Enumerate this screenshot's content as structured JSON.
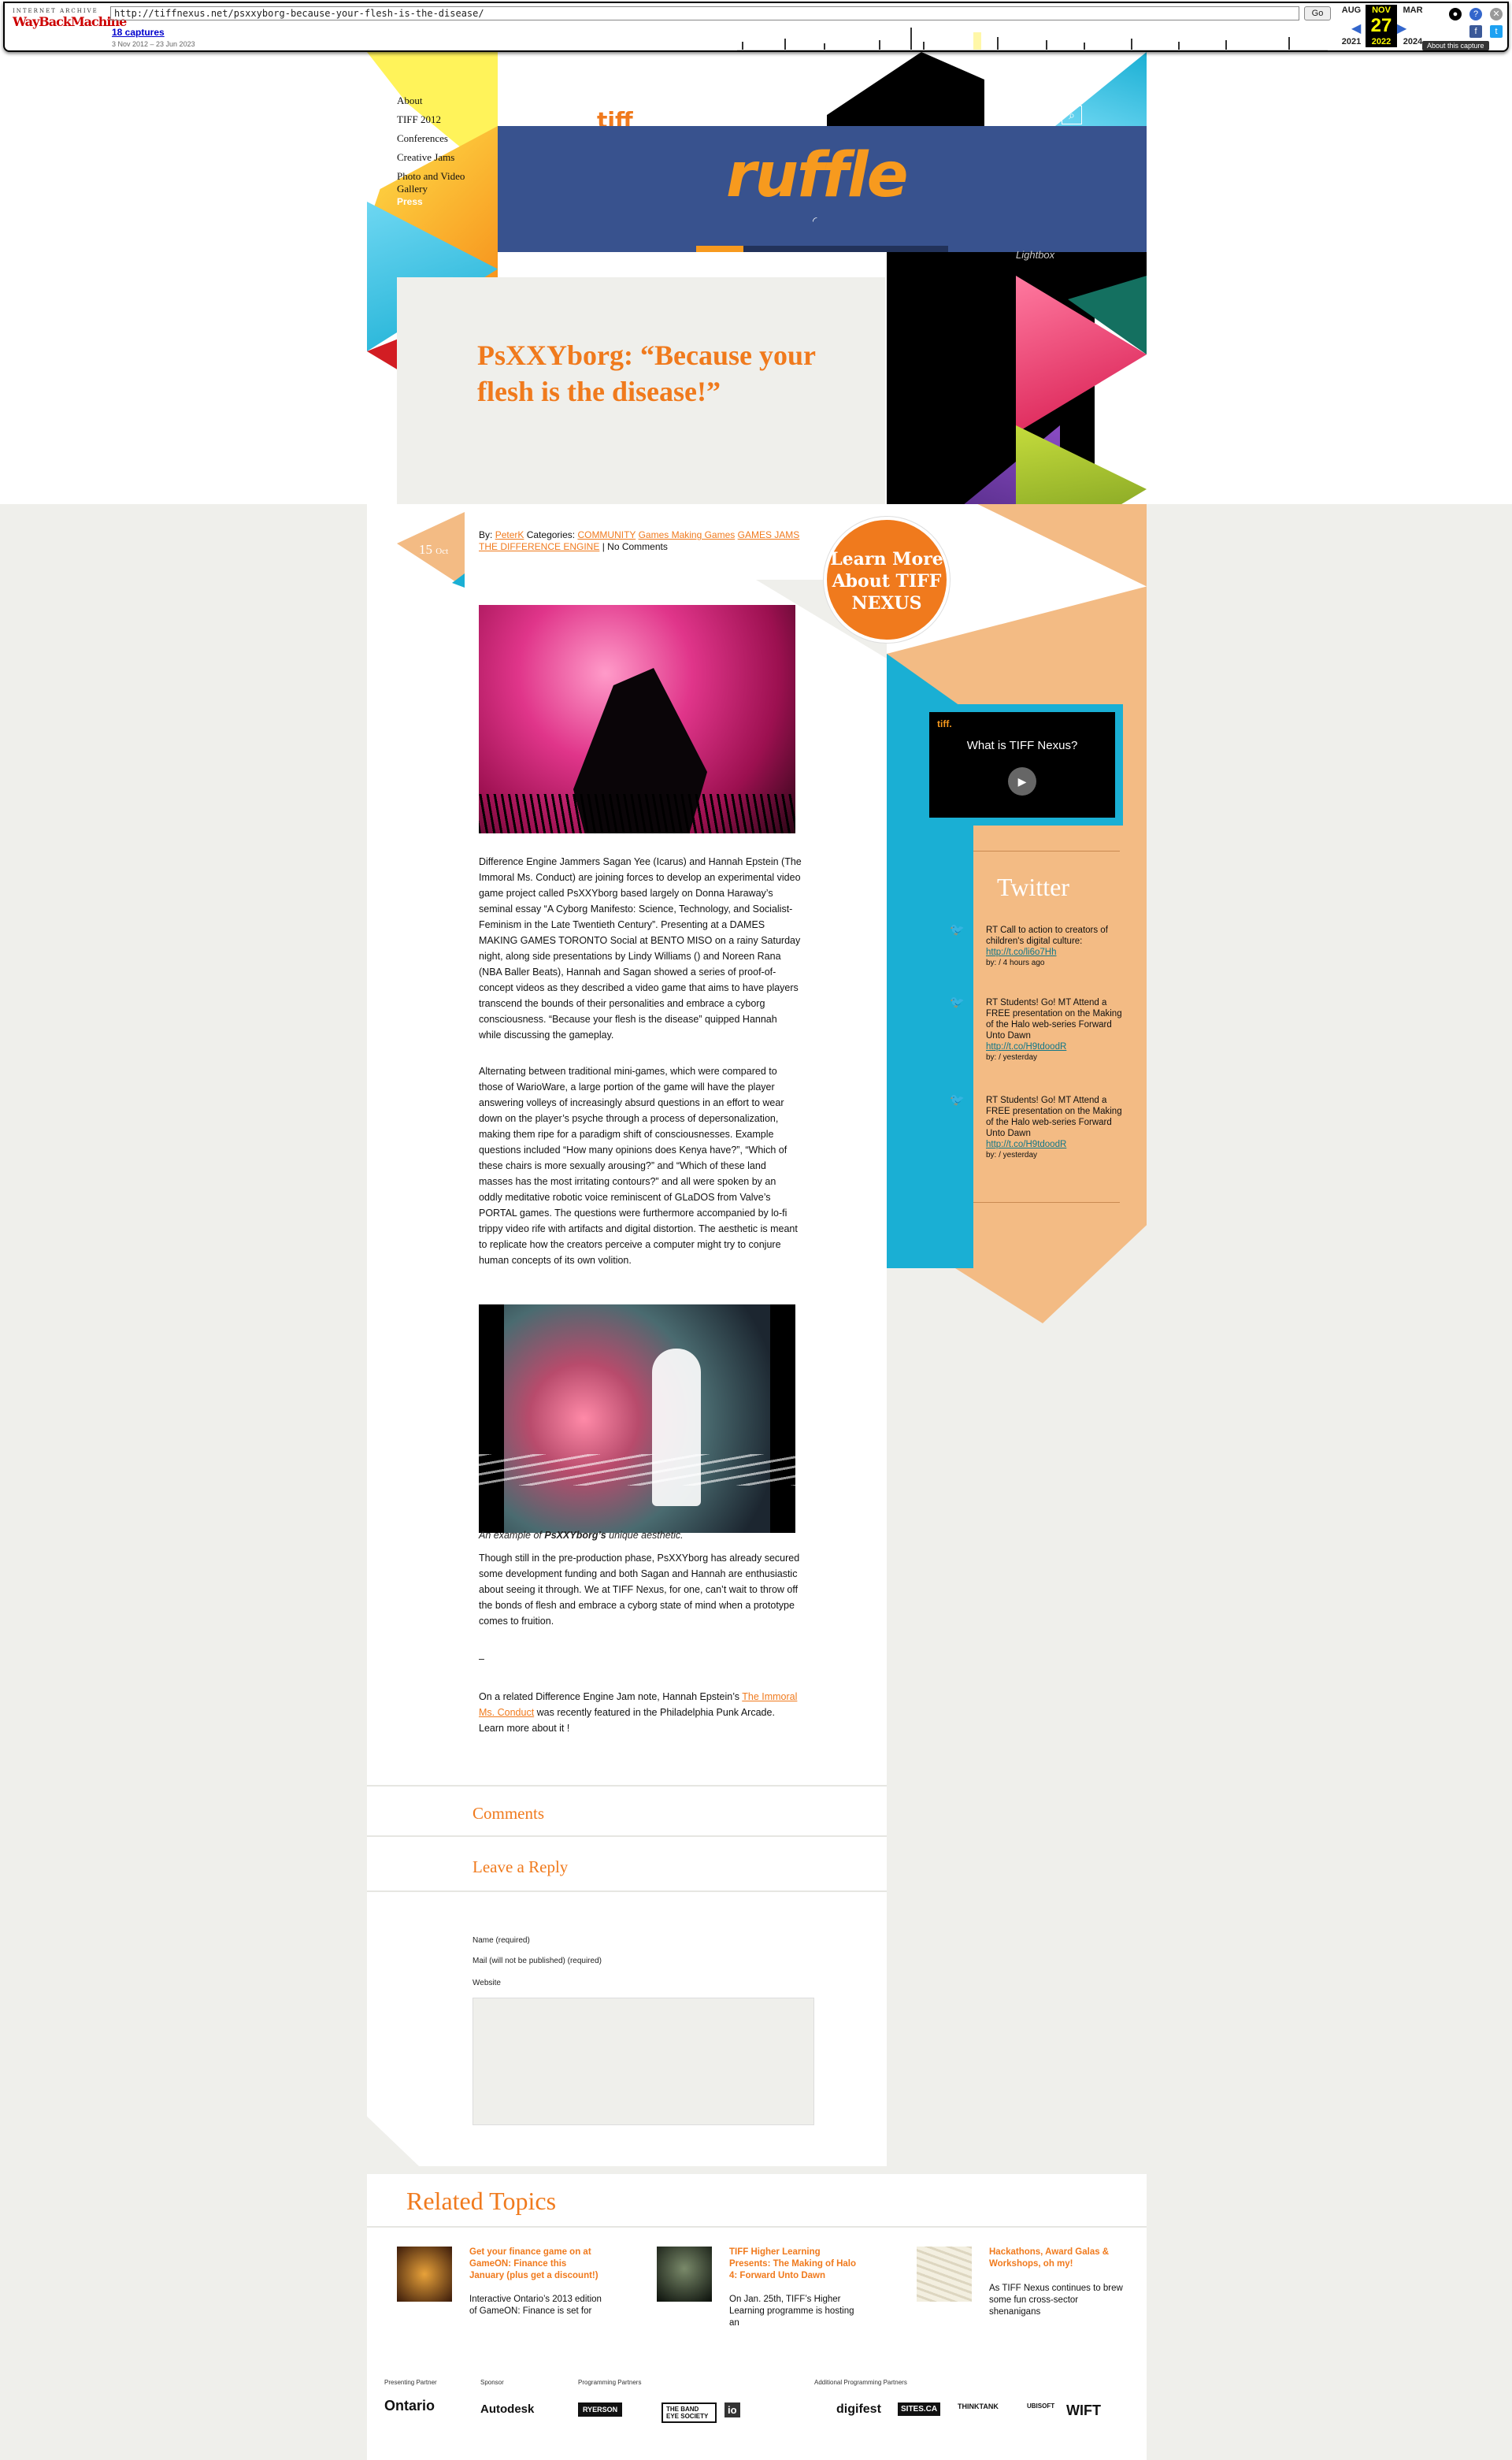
{
  "wayback": {
    "logo_small": "INTERNET ARCHIVE",
    "logo_big": "WayBackMachine",
    "url": "http://tiffnexus.net/psxxyborg-because-your-flesh-is-the-disease/",
    "go": "Go",
    "captures": "18 captures",
    "range": "3 Nov 2012 – 23 Jun 2023",
    "prev_month": "AUG",
    "prev_year": "2021",
    "cur_month": "NOV",
    "cur_day": "27",
    "cur_year": "2022",
    "next_month": "MAR",
    "next_year": "2024",
    "about": "About this capture"
  },
  "nav": {
    "items": [
      "About",
      "TIFF 2012",
      "Conferences",
      "Creative Jams",
      "Photo and Video Gallery"
    ],
    "press": "Press"
  },
  "header": {
    "tiff": "tiff",
    "logo": "ruffle",
    "lightbox": "Lightbox"
  },
  "post": {
    "title": "PsXXYborg: “Because your flesh is the disease!”",
    "date_day": "15",
    "date_month": "Oct",
    "by_label": "By:",
    "author": "PeterK",
    "categories_label": "Categories:",
    "categories": [
      "COMMUNITY",
      "Games Making Games",
      "GAMES JAMS",
      "THE DIFFERENCE ENGINE"
    ],
    "comments_link": "No Comments",
    "p1": "Difference Engine Jammers Sagan Yee (Icarus) and Hannah Epstein (The Immoral Ms. Conduct) are joining forces to develop an experimental video game project called PsXXYborg based largely on Donna Haraway’s seminal essay “A Cyborg Manifesto: Science, Technology, and Socialist-Feminism in the Late Twentieth Century”. Presenting at a DAMES MAKING GAMES TORONTO Social at BENTO MISO on a rainy Saturday night, along side presentations by Lindy Williams () and Noreen Rana (NBA Baller Beats), Hannah and Sagan showed a series of proof-of-concept videos as they described a video game that aims to have players transcend the bounds of their personalities and embrace a cyborg consciousness. “Because your flesh is the disease” quipped Hannah while discussing the gameplay.",
    "p2": "Alternating between traditional mini-games, which were compared to those of WarioWare, a large portion of the game will have the player answering volleys of increasingly absurd questions in an effort to wear down on the player’s psyche through a process of depersonalization, making them ripe for a paradigm shift of consciousnesses. Example questions included “How many opinions does Kenya have?”, “Which of these chairs is more sexually arousing?” and “Which of these land masses has the most irritating contours?” and all were spoken by an oddly meditative robotic voice reminiscent of GLaDOS from Valve’s PORTAL games. The questions were furthermore accompanied by lo-fi trippy video rife with artifacts and digital distortion. The aesthetic is meant to replicate how the creators perceive a computer might try to conjure human concepts of its own volition.",
    "caption_pre": "An example of ",
    "caption_bold": "PsXXYborg’s",
    "caption_post": " unique aesthetic.",
    "p3": "Though still in the pre-production phase, PsXXYborg has already secured some development funding and both Sagan and Hannah are enthusiastic about seeing it through. We at TIFF Nexus, for one, can’t wait to throw off the bonds of flesh and embrace a cyborg state of mind when a prototype comes to fruition.",
    "dash": "–",
    "p4_pre": "On a related Difference Engine Jam note, Hannah Epstein’s ",
    "p4_link": "The Immoral Ms. Conduct",
    "p4_post": " was recently featured in the Philadelphia Punk Arcade. Learn more about it !"
  },
  "learn_more": "Learn More About TIFF NEXUS",
  "comments_heading": "Comments",
  "reply": {
    "heading": "Leave a Reply",
    "name_label": "Name (required)",
    "mail_label": "Mail (will not be published) (required)",
    "website_label": "Website"
  },
  "sidebar": {
    "video_tiff": "tiff.",
    "video_title": "What is TIFF Nexus?",
    "twitter_heading": "Twitter",
    "tweets": [
      {
        "text": "RT Call to action to creators of children's digital culture:",
        "link": "http://t.co/li6o7Hh",
        "by": "by: / 4 hours ago"
      },
      {
        "text": "RT Students! Go! MT Attend a FREE presentation on the Making of the Halo web-series Forward Unto Dawn",
        "link": "http://t.co/H9tdoodR",
        "by": "by: / yesterday"
      },
      {
        "text": "RT Students! Go! MT Attend a FREE presentation on the Making of the Halo web-series Forward Unto Dawn",
        "link": "http://t.co/H9tdoodR",
        "by": "by: / yesterday"
      }
    ]
  },
  "related": {
    "heading": "Related Topics",
    "items": [
      {
        "title": "Get your finance game on at GameON: Finance this January (plus get a discount!)",
        "desc": "Interactive Ontario’s 2013 edition of GameON: Finance is set for"
      },
      {
        "title": "TIFF Higher Learning Presents: The Making of Halo 4: Forward Unto Dawn",
        "desc": "On Jan. 25th, TIFF’s Higher Learning programme is hosting an"
      },
      {
        "title": "Hackathons, Award Galas & Workshops, oh my!",
        "desc": "As TIFF Nexus continues to brew some fun cross-sector shenanigans"
      }
    ]
  },
  "footer": {
    "presenting_label": "Presenting Partner",
    "sponsor_label": "Sponsor",
    "programming_label": "Programming Partners",
    "additional_label": "Additional Programming Partners",
    "logos": [
      "Ontario",
      "Autodesk",
      "RYERSON",
      "THE BAND EYE SOCIETY",
      "io",
      "digifest",
      "SITES.CA",
      "THINKTANK",
      "UBISOFT",
      "WIFT"
    ]
  },
  "colors": {
    "orange": "#f07a1d",
    "cyan": "#1aafd4",
    "peach": "#f3bb84",
    "navy": "#38528e"
  }
}
